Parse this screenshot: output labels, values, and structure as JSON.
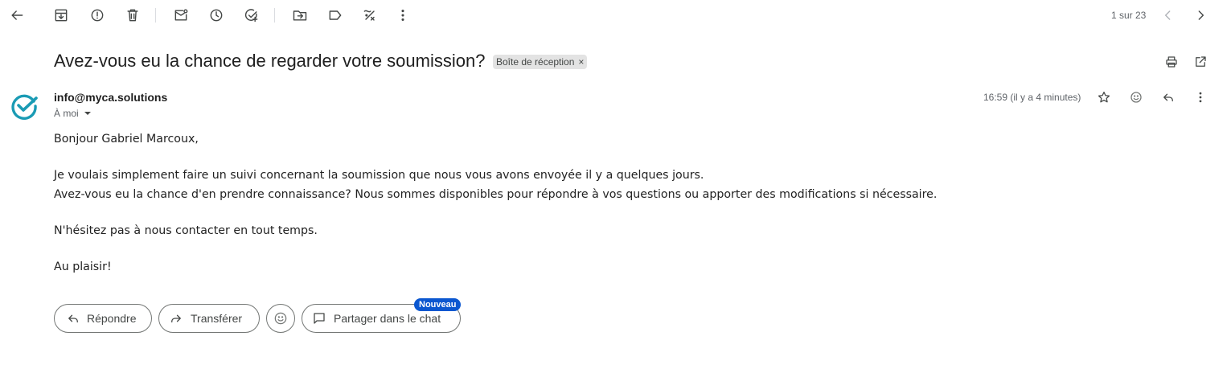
{
  "toolbar": {
    "icons": [
      "arrow-back-icon",
      "archive-icon",
      "report-spam-icon",
      "trash-icon",
      "mark-unread-icon",
      "snooze-icon",
      "add-task-icon",
      "move-to-icon",
      "label-icon",
      "more-options-icon"
    ],
    "pager": "1 sur 23"
  },
  "thread": {
    "subject": "Avez-vous eu la chance de regarder votre soumission?",
    "label": "Boîte de réception",
    "label_close": "×"
  },
  "message": {
    "sender": "info@myca.solutions",
    "recipient": "À moi",
    "timestamp": "16:59 (il y a 4 minutes)",
    "greeting": "Bonjour Gabriel Marcoux,",
    "line1": "Je voulais simplement faire un suivi concernant la soumission que nous vous avons envoyée il y a quelques jours.",
    "line2": "Avez-vous eu la chance d'en prendre connaissance? Nous sommes disponibles pour répondre à vos questions ou apporter des modifications si nécessaire.",
    "line3": "N'hésitez pas à nous contacter en tout temps.",
    "closing": "Au plaisir!"
  },
  "actions": {
    "reply": "Répondre",
    "forward": "Transférer",
    "share_chat": "Partager dans le chat",
    "new_badge": "Nouveau"
  },
  "colors": {
    "avatar_accent": "#1a9bb4",
    "badge": "#0b57d0",
    "chip_bg": "#e3e3e3"
  }
}
